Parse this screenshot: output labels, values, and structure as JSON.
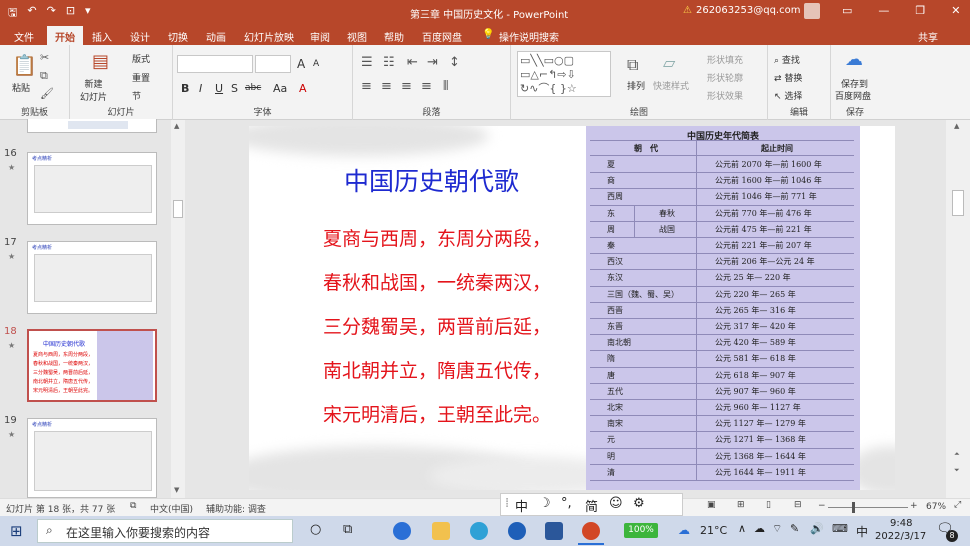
{
  "window": {
    "title": "第三章 中国历史文化 - PowerPoint",
    "user_email": "262063253@qq.com",
    "warning_icon": "warning-icon",
    "qat_icons": [
      "save-icon",
      "undo-icon",
      "redo-icon",
      "present-icon",
      "customize-icon"
    ]
  },
  "tabs": [
    "文件",
    "开始",
    "插入",
    "设计",
    "切换",
    "动画",
    "幻灯片放映",
    "审阅",
    "视图",
    "帮助",
    "百度网盘",
    "操作说明搜索"
  ],
  "share_label": "共享",
  "ribbon": {
    "clipboard": {
      "paste": "粘贴",
      "label": "剪贴板"
    },
    "slides": {
      "new_slide": "新建\n幻灯片",
      "layout": "版式",
      "reset": "重置",
      "section": "节",
      "label": "幻灯片"
    },
    "font": {
      "label": "字体",
      "size_grow": "A",
      "size_shrink": "A",
      "bold": "B",
      "italic": "I",
      "underline": "U",
      "strike": "S",
      "abc": "abc",
      "aa": "Aa",
      "font_color": "A"
    },
    "paragraph": {
      "label": "段落"
    },
    "drawing": {
      "arrange": "排列",
      "quick_styles": "快速样式",
      "shape_fill": "形状填充",
      "shape_outline": "形状轮廓",
      "shape_effects": "形状效果",
      "label": "绘图"
    },
    "editing": {
      "find": "查找",
      "replace": "替换",
      "select": "选择",
      "label": "编辑"
    },
    "save": {
      "line1": "保存到",
      "line2": "百度网盘",
      "label": "保存"
    }
  },
  "thumbnails": [
    {
      "num": "16",
      "title": "考点精析"
    },
    {
      "num": "17",
      "title": "考点精析"
    },
    {
      "num": "18",
      "title": "中国历史朝代歌",
      "selected": true
    },
    {
      "num": "19",
      "title": "考点精析"
    }
  ],
  "slide": {
    "title": "中国历史朝代歌",
    "poem": [
      "夏商与西周，东周分两段，",
      "春秋和战国，一统秦两汉，",
      "三分魏蜀吴，两晋前后延，",
      "南北朝并立，隋唐五代传，",
      "宋元明清后，王朝至此完。"
    ],
    "table": {
      "title": "中国历史年代简表",
      "headers": [
        "朝　代",
        "起止时间"
      ],
      "rows": [
        [
          "夏",
          "",
          "公元前 2070 年—前 1600 年"
        ],
        [
          "商",
          "",
          "公元前 1600 年—前 1046 年"
        ],
        [
          "西周",
          "",
          "公元前 1046 年—前 771 年"
        ],
        [
          "东",
          "春秋",
          "公元前 770 年—前 476 年"
        ],
        [
          "周",
          "战国",
          "公元前 475 年—前 221 年"
        ],
        [
          "秦",
          "",
          "公元前 221 年—前 207 年"
        ],
        [
          "西汉",
          "",
          "公元前 206 年—公元 24 年"
        ],
        [
          "东汉",
          "",
          "公元 25 年— 220 年"
        ],
        [
          "三国（魏、蜀、吴）",
          "",
          "公元 220 年— 265 年"
        ],
        [
          "西晋",
          "",
          "公元 265 年— 316 年"
        ],
        [
          "东晋",
          "",
          "公元 317 年— 420 年"
        ],
        [
          "南北朝",
          "",
          "公元 420 年— 589 年"
        ],
        [
          "隋",
          "",
          "公元 581 年— 618 年"
        ],
        [
          "唐",
          "",
          "公元 618 年— 907 年"
        ],
        [
          "五代",
          "",
          "公元 907 年— 960 年"
        ],
        [
          "北宋",
          "",
          "公元 960 年— 1127 年"
        ],
        [
          "南宋",
          "",
          "公元 1127 年— 1279 年"
        ],
        [
          "元",
          "",
          "公元 1271 年— 1368 年"
        ],
        [
          "明",
          "",
          "公元 1368 年— 1644 年"
        ],
        [
          "清",
          "",
          "公元 1644 年— 1911 年"
        ]
      ]
    }
  },
  "status": {
    "slide_info": "幻灯片 第 18 张，共 77 张",
    "language": "中文(中国)",
    "accessibility": "辅助功能: 调查",
    "notes": "批注",
    "zoom": "67%",
    "zoom_level": 0.67,
    "zoom_minus": "−",
    "zoom_plus": "+"
  },
  "ime": {
    "mode": "中",
    "punct": "°,",
    "simp": "简"
  },
  "taskbar": {
    "search_placeholder": "在这里输入你要搜索的内容",
    "battery": "100%",
    "temperature": "21°C",
    "ime_indicator": "中",
    "time": "9:48",
    "date": "2022/3/17",
    "notification_count": "8"
  },
  "colors": {
    "accent": "#b7472a",
    "slide_title": "#1e2ad0",
    "poem": "#e4141b",
    "table_bg": "#cbc6ea"
  }
}
